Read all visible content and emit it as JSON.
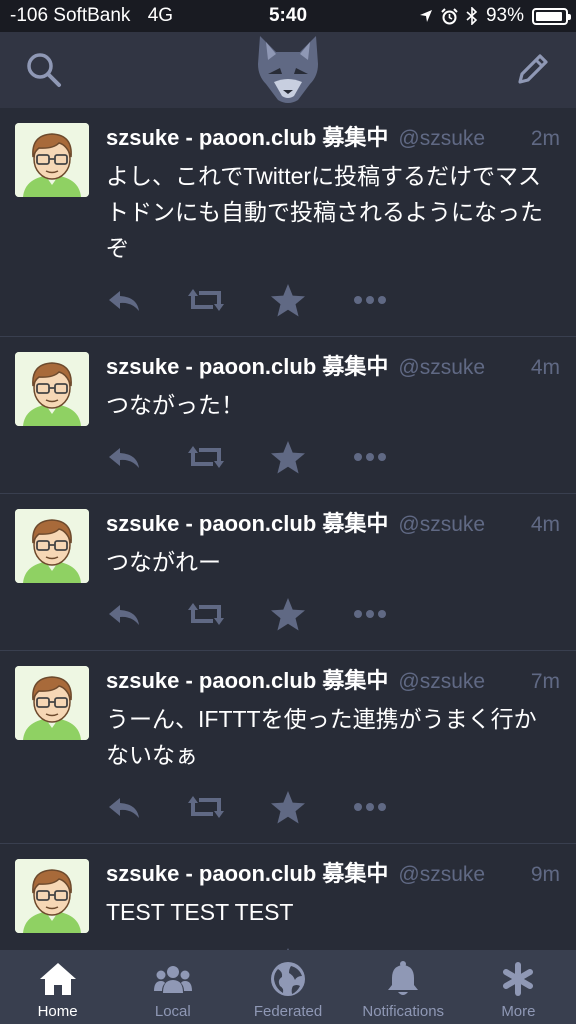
{
  "status_bar": {
    "carrier": "-106 SoftBank",
    "network": "4G",
    "time": "5:40",
    "battery": "93%",
    "battery_level": 0.93
  },
  "nav": {
    "search_icon": "search-icon",
    "logo": "mastodon-logo",
    "compose_icon": "compose-icon"
  },
  "toots": [
    {
      "display_name": "szsuke - paoon.club 募集中",
      "acct": "@szsuke",
      "time": "2m",
      "content": "よし、これでTwitterに投稿するだけでマストドンにも自動で投稿されるようになったぞ"
    },
    {
      "display_name": "szsuke - paoon.club 募集中",
      "acct": "@szsuke",
      "time": "4m",
      "content": "つながった！"
    },
    {
      "display_name": "szsuke - paoon.club 募集中",
      "acct": "@szsuke",
      "time": "4m",
      "content": "つながれー"
    },
    {
      "display_name": "szsuke - paoon.club 募集中",
      "acct": "@szsuke",
      "time": "7m",
      "content": "うーん、IFTTTを使った連携がうまく行かないなぁ"
    },
    {
      "display_name": "szsuke - paoon.club 募集中",
      "acct": "@szsuke",
      "time": "9m",
      "content": "TEST TEST TEST"
    }
  ],
  "tabs": [
    {
      "label": "Home",
      "icon": "home-icon"
    },
    {
      "label": "Local",
      "icon": "users-icon"
    },
    {
      "label": "Federated",
      "icon": "globe-icon"
    },
    {
      "label": "Notifications",
      "icon": "bell-icon"
    },
    {
      "label": "More",
      "icon": "asterisk-icon"
    }
  ],
  "colors": {
    "background": "#282c37",
    "nav_background": "#313543",
    "tab_background": "#393f4f",
    "muted": "#606984",
    "active_tab": "#ffffff"
  }
}
